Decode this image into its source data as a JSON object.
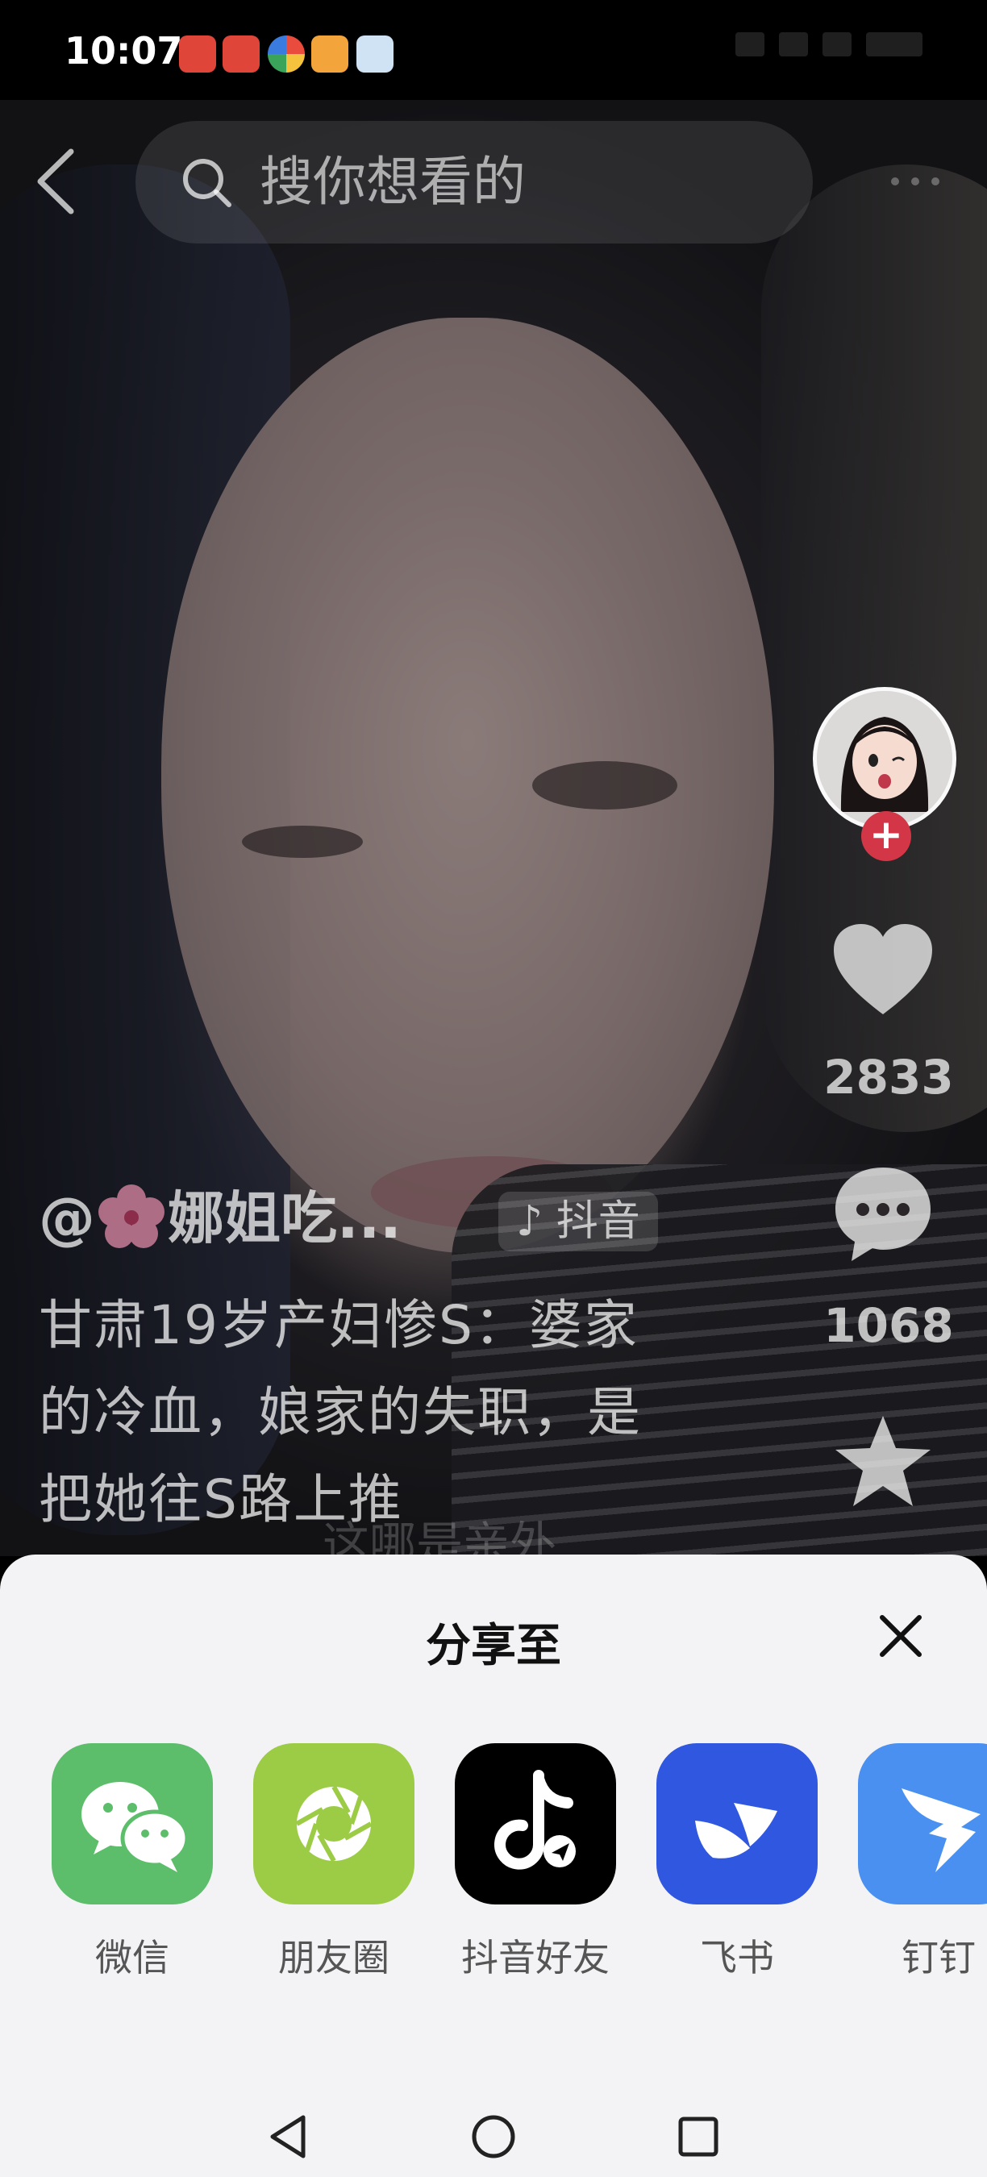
{
  "status_bar": {
    "time": "10:07"
  },
  "search": {
    "placeholder": "搜你想看的"
  },
  "video": {
    "author": "娜姐吃...",
    "author_prefix": "@",
    "platform_tag": "抖音",
    "description": "甘肃19岁产妇惨S：婆家的冷血，娘家的失职，是把她往S路上推",
    "caption_ghost": "这哪是亲外",
    "like_count": "2833",
    "comment_count": "1068"
  },
  "share_sheet": {
    "title": "分享至",
    "targets": [
      {
        "label": "微信",
        "icon": "wechat-icon",
        "color": "#5cbd6a"
      },
      {
        "label": "朋友圈",
        "icon": "moments-icon",
        "color": "#9ccb45"
      },
      {
        "label": "抖音好友",
        "icon": "douyin-icon",
        "color": "#000000"
      },
      {
        "label": "飞书",
        "icon": "feishu-icon",
        "color": "#2f57e0"
      },
      {
        "label": "钉钉",
        "icon": "dingtalk-icon",
        "color": "#4a90f0"
      }
    ]
  },
  "colors": {
    "follow_badge": "#d33747",
    "sheet_background": "#f3f3f5"
  }
}
